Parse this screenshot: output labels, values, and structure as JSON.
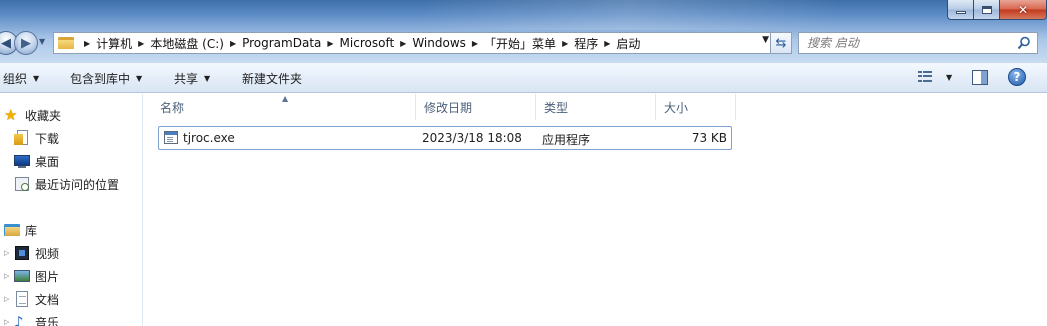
{
  "window": {
    "minimize_icon": "minimize-icon",
    "maximize_icon": "maximize-icon",
    "close_icon": "close-icon"
  },
  "address": {
    "crumbs": [
      "计算机",
      "本地磁盘 (C:)",
      "ProgramData",
      "Microsoft",
      "Windows",
      "「开始」菜单",
      "程序",
      "启动"
    ]
  },
  "search": {
    "placeholder": "搜索 启动"
  },
  "toolbar": {
    "organize": "组织",
    "include_in_library": "包含到库中",
    "share": "共享",
    "new_folder": "新建文件夹"
  },
  "nav": {
    "favorites": "收藏夹",
    "downloads": "下载",
    "desktop": "桌面",
    "recent": "最近访问的位置",
    "libraries": "库",
    "videos": "视频",
    "pictures": "图片",
    "documents": "文档",
    "music": "音乐"
  },
  "columns": {
    "name": "名称",
    "modified": "修改日期",
    "type": "类型",
    "size": "大小"
  },
  "files": [
    {
      "name": "tjroc.exe",
      "modified": "2023/3/18 18:08",
      "type": "应用程序",
      "size": "73 KB"
    }
  ],
  "colors": {
    "selection_border": "#7da2ce",
    "header_text": "#4c607a"
  }
}
